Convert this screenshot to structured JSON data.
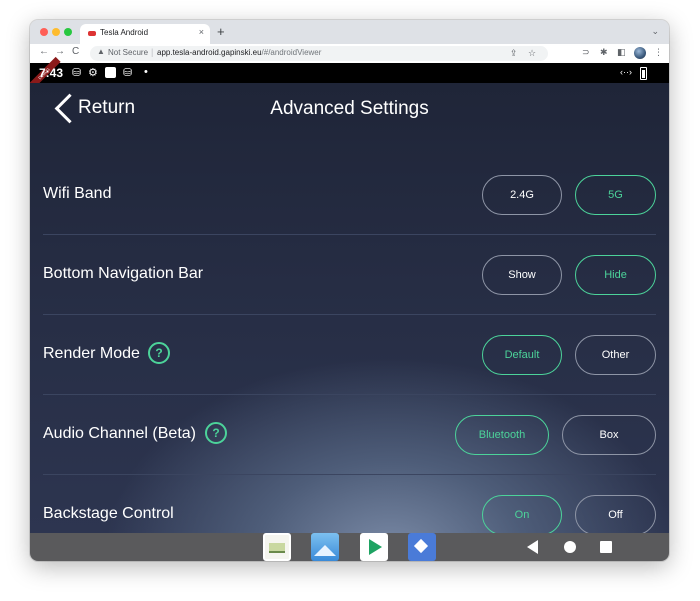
{
  "browser": {
    "tab_title": "Tesla Android",
    "tab_close": "×",
    "new_tab": "+",
    "tab_menu": "⌄",
    "nav_back": "←",
    "nav_forward": "→",
    "nav_reload": "C",
    "security_label": "Not Secure",
    "url_host": "app.tesla-android.gapinski.eu",
    "url_path": "/#/androidViewer"
  },
  "statusbar": {
    "ribbon": "DEBUG",
    "time": "7:43"
  },
  "app": {
    "return_label": "Return",
    "title": "Advanced Settings",
    "help_glyph": "?",
    "rows": [
      {
        "label": "Wifi Band",
        "options": [
          "2.4G",
          "5G"
        ],
        "selected": "5G"
      },
      {
        "label": "Bottom Navigation Bar",
        "options": [
          "Show",
          "Hide"
        ],
        "selected": "Hide"
      },
      {
        "label": "Render Mode",
        "options": [
          "Default",
          "Other"
        ],
        "selected": "Default"
      },
      {
        "label": "Audio Channel (Beta)",
        "options": [
          "Bluetooth",
          "Box"
        ],
        "selected": "Bluetooth"
      },
      {
        "label": "Backstage Control",
        "options": [
          "On",
          "Off"
        ],
        "selected": "On"
      }
    ]
  },
  "colors": {
    "accent": "#4cd39a",
    "background": "#262d44",
    "pill_border": "#8e95a6"
  }
}
